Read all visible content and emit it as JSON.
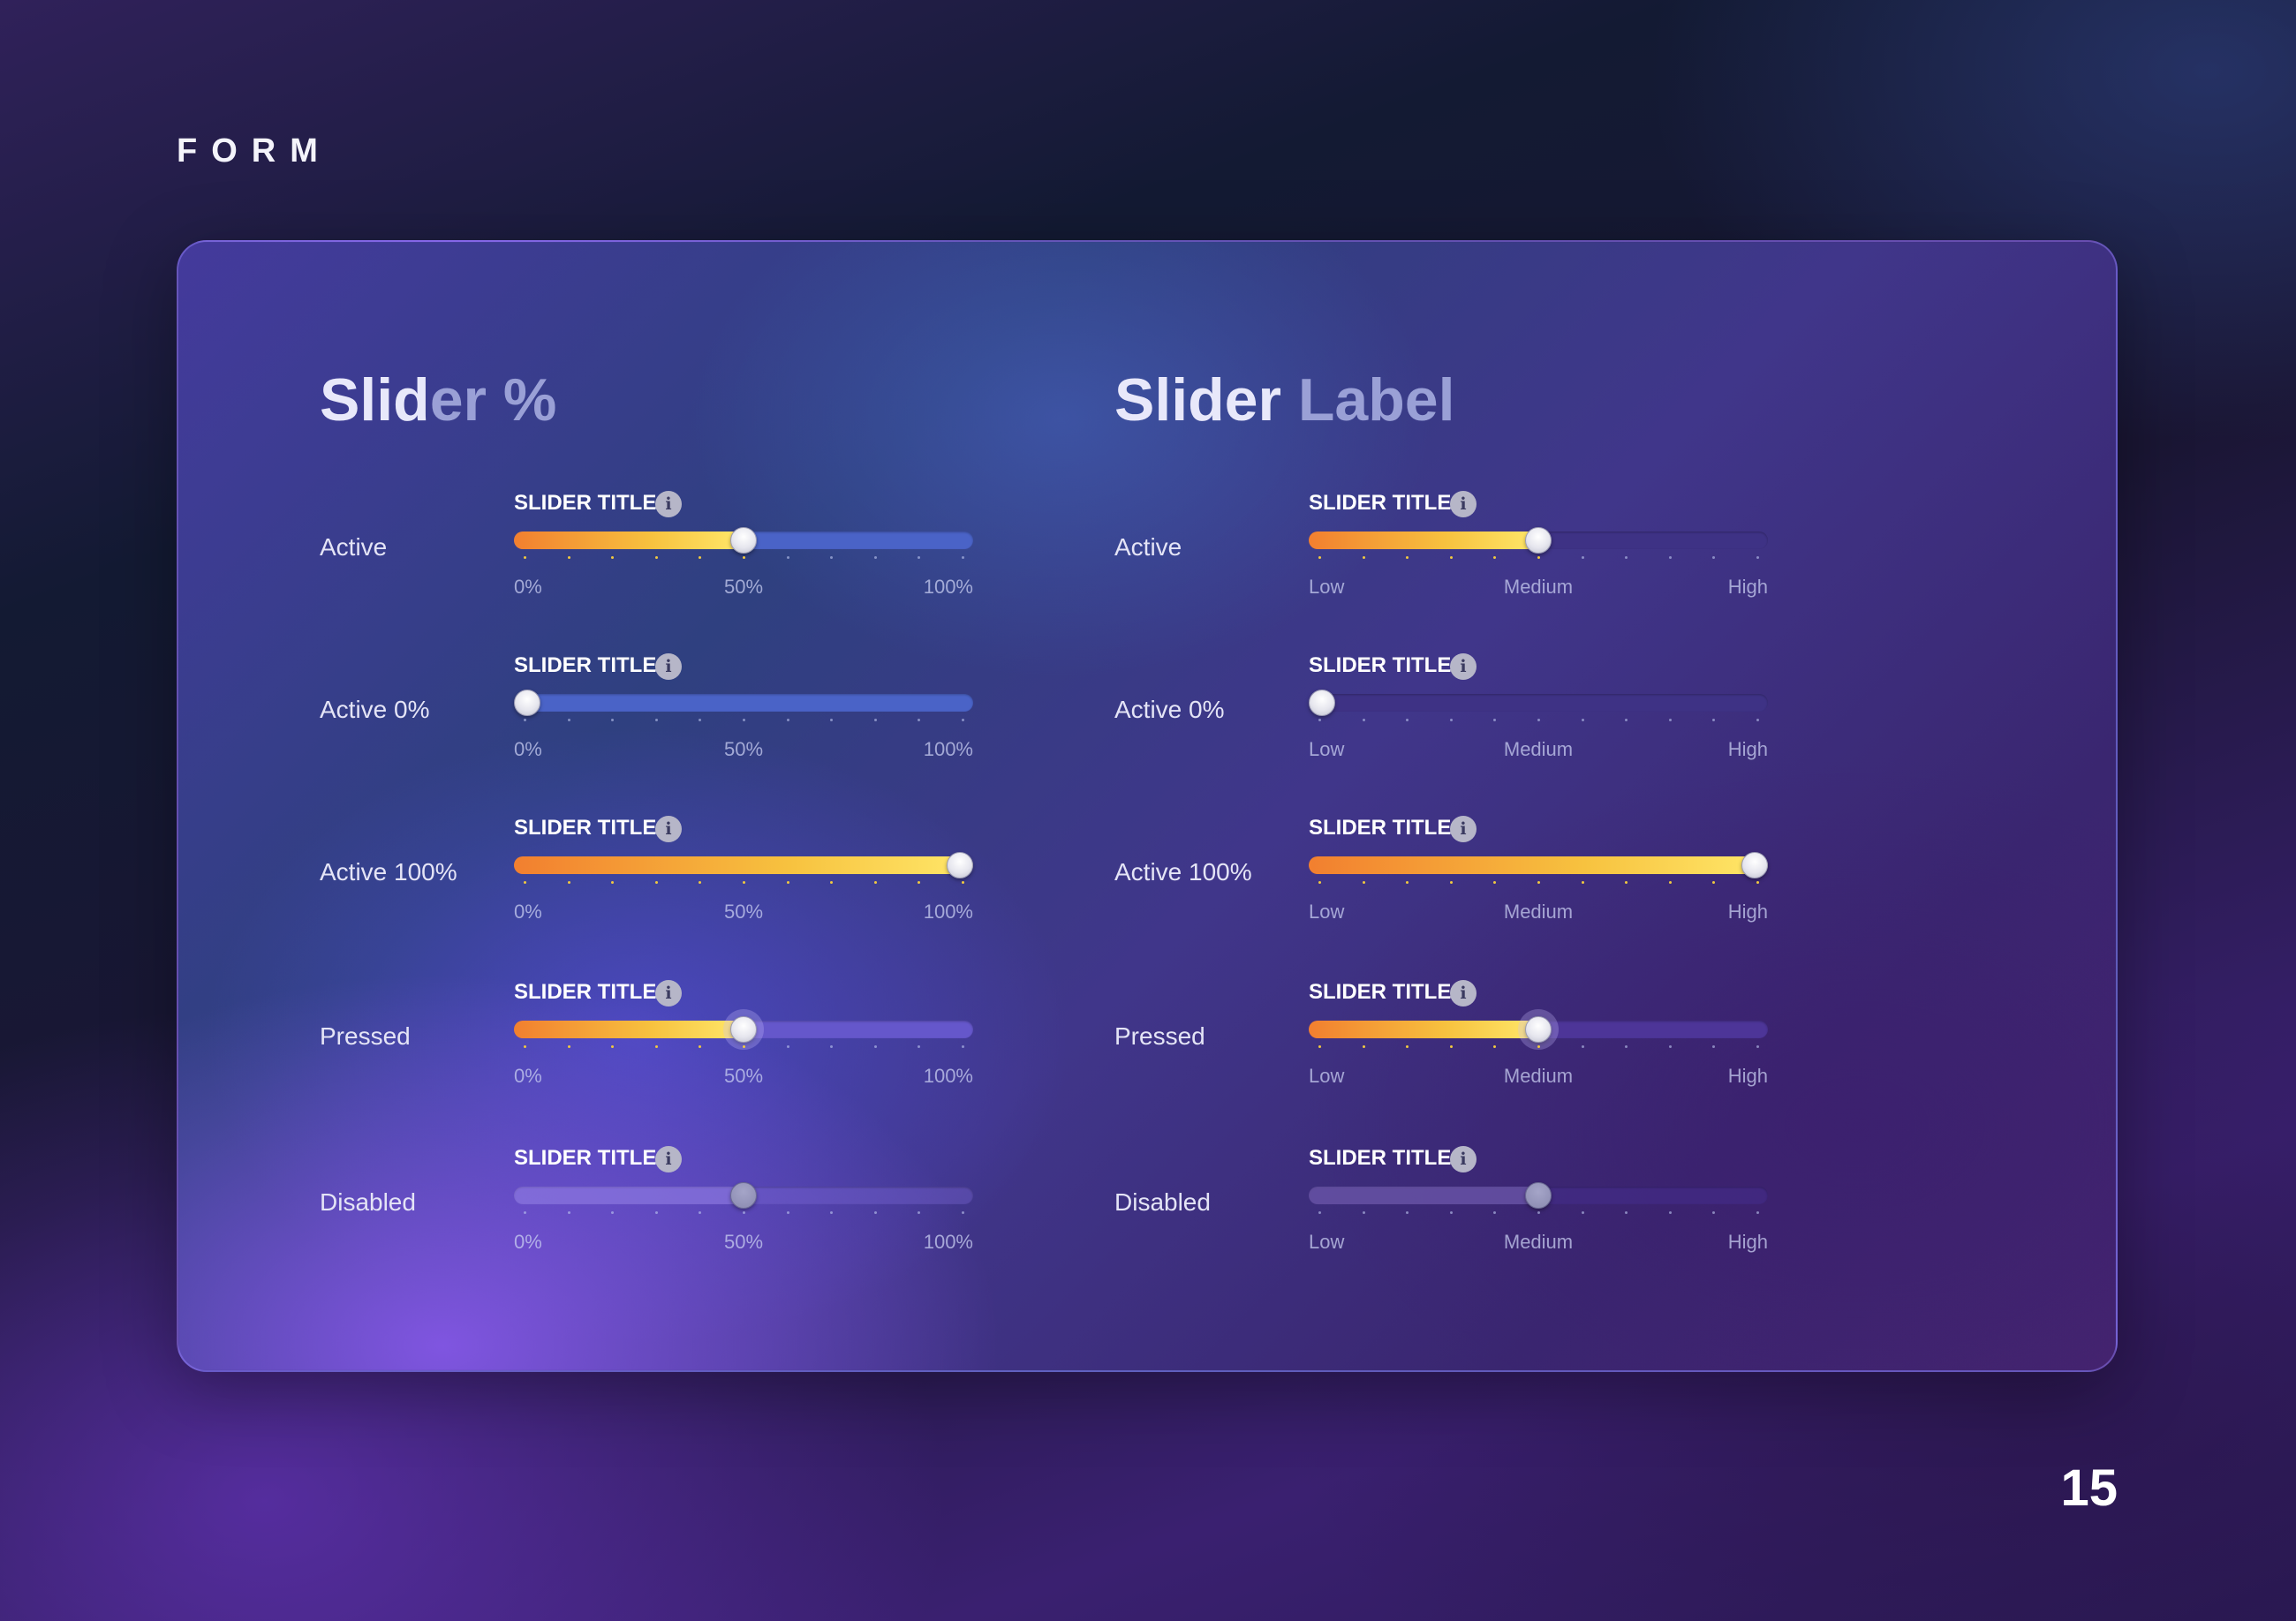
{
  "header": {
    "section_label": "FORM"
  },
  "footer": {
    "page_number": "15"
  },
  "columns": [
    {
      "title_a": "Slid",
      "title_b": "er %",
      "scale": [
        "0%",
        "50%",
        "100%"
      ],
      "rows": [
        {
          "label": "Active",
          "slider_title": "SLIDER TITLE:",
          "value": 0.5,
          "state": "active"
        },
        {
          "label": "Active 0%",
          "slider_title": "SLIDER TITLE:",
          "value": 0.0,
          "state": "active"
        },
        {
          "label": "Active 100%",
          "slider_title": "SLIDER TITLE:",
          "value": 1.0,
          "state": "active"
        },
        {
          "label": "Pressed",
          "slider_title": "SLIDER TITLE:",
          "value": 0.5,
          "state": "pressed"
        },
        {
          "label": "Disabled",
          "slider_title": "SLIDER TITLE:",
          "value": 0.5,
          "state": "disabled"
        }
      ]
    },
    {
      "title_a": "Slider",
      "title_b": "Label",
      "scale": [
        "Low",
        "Medium",
        "High"
      ],
      "rows": [
        {
          "label": "Active",
          "slider_title": "SLIDER TITLE:",
          "value": 0.5,
          "state": "active"
        },
        {
          "label": "Active 0%",
          "slider_title": "SLIDER TITLE:",
          "value": 0.0,
          "state": "active"
        },
        {
          "label": "Active 100%",
          "slider_title": "SLIDER TITLE:",
          "value": 1.0,
          "state": "active"
        },
        {
          "label": "Pressed",
          "slider_title": "SLIDER TITLE:",
          "value": 0.5,
          "state": "pressed"
        },
        {
          "label": "Disabled",
          "slider_title": "SLIDER TITLE:",
          "value": 0.5,
          "state": "disabled"
        }
      ]
    }
  ],
  "colors": {
    "fill_start": "#f27f2f",
    "fill_end": "#ffe86a",
    "track_percent": "#4a63c7",
    "track_label": "#3e3285"
  },
  "icons": {
    "info": "info-icon"
  }
}
